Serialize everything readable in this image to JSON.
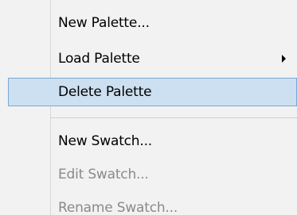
{
  "menu": {
    "items": [
      {
        "label": "New Palette...",
        "enabled": true
      },
      {
        "label": "Load Palette",
        "enabled": true,
        "submenu_icon": "chevron-right-icon"
      },
      {
        "label": "Delete Palette",
        "enabled": true,
        "highlighted": true
      },
      {
        "label": "New Swatch...",
        "enabled": true
      },
      {
        "label": "Edit Swatch...",
        "enabled": false
      },
      {
        "label": "Rename Swatch...",
        "enabled": false
      }
    ]
  },
  "colors": {
    "background": "#f2f2f2",
    "highlight": "#cde0f1",
    "highlight_border": "#7aa9d6",
    "disabled_text": "#8a8a8a"
  }
}
